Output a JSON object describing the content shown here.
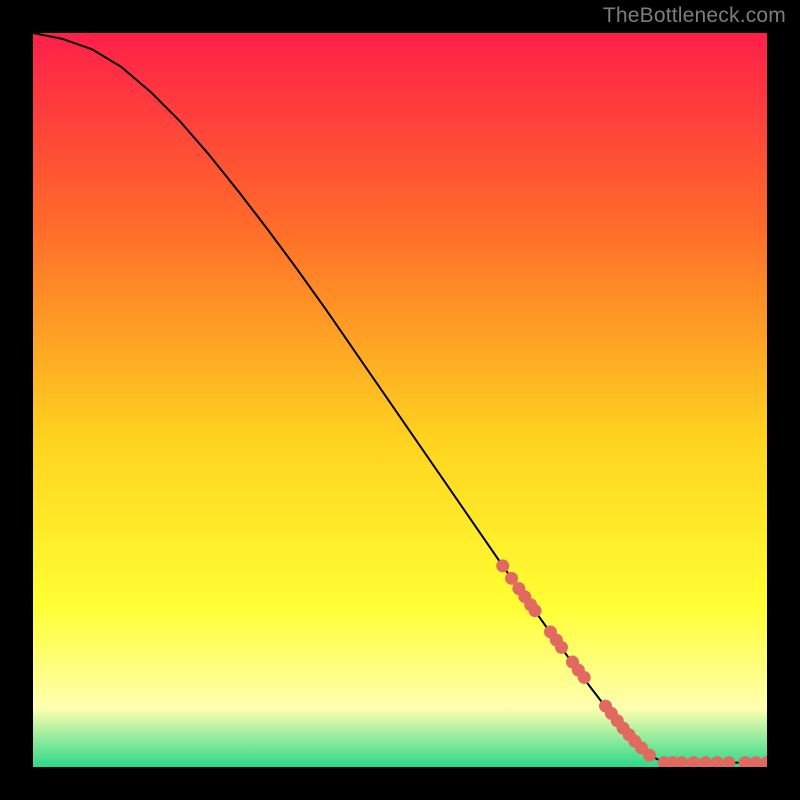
{
  "watermark": "TheBottleneck.com",
  "colors": {
    "background": "#000000",
    "watermark": "#7d7d7d",
    "gradient_top": "#ff1f49",
    "gradient_mid1": "#ff6a2a",
    "gradient_mid2": "#ffd21f",
    "gradient_mid3": "#ffff33",
    "gradient_pale": "#ffffb0",
    "gradient_bottom": "#2cd98b",
    "line": "#000000",
    "marker": "#e2695f"
  },
  "chart_data": {
    "type": "line",
    "title": "",
    "xlabel": "",
    "ylabel": "",
    "xlim": [
      0,
      100
    ],
    "ylim": [
      0,
      100
    ],
    "series": [
      {
        "name": "curve",
        "x": [
          0,
          4,
          8,
          12,
          16,
          20,
          24,
          28,
          32,
          36,
          40,
          44,
          48,
          52,
          56,
          60,
          64,
          68,
          72,
          76,
          80,
          84,
          86,
          90,
          94,
          98,
          100
        ],
        "y": [
          100,
          99.2,
          97.8,
          95.4,
          92.0,
          88.0,
          83.4,
          78.4,
          73.2,
          67.8,
          62.2,
          56.4,
          50.6,
          44.8,
          39.0,
          33.2,
          27.4,
          21.8,
          16.2,
          10.8,
          5.6,
          1.6,
          0.6,
          0.6,
          0.6,
          0.6,
          0.6
        ]
      }
    ],
    "markers": {
      "name": "highlight-points",
      "x": [
        64.0,
        65.2,
        66.2,
        67.0,
        67.8,
        68.4,
        70.5,
        71.3,
        72.0,
        73.5,
        74.3,
        75.1,
        78.0,
        78.8,
        79.6,
        80.4,
        81.2,
        82.0,
        82.9,
        84.0,
        86.0,
        87.2,
        88.4,
        90.0,
        91.6,
        93.2,
        94.8,
        97.0,
        98.5,
        100.0
      ],
      "y": [
        27.4,
        25.7,
        24.3,
        23.2,
        22.1,
        21.3,
        18.4,
        17.3,
        16.3,
        14.3,
        13.2,
        12.2,
        8.3,
        7.3,
        6.3,
        5.3,
        4.4,
        3.5,
        2.6,
        1.6,
        0.6,
        0.6,
        0.6,
        0.6,
        0.6,
        0.6,
        0.6,
        0.6,
        0.6,
        0.6
      ]
    }
  }
}
